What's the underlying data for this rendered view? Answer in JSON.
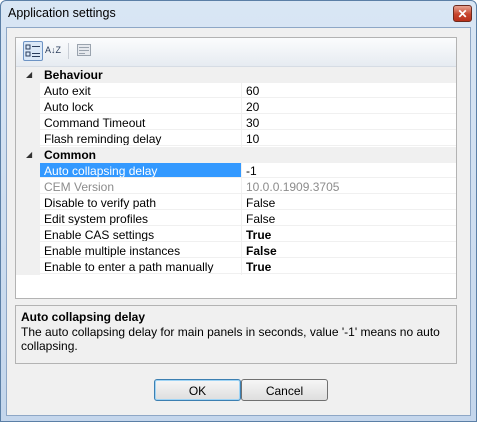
{
  "window": {
    "title": "Application settings",
    "close_glyph": "✕"
  },
  "toolbar": {
    "categorized_icon": "categorized-icon",
    "alphabetical_icon": "alphabetical-sort-icon",
    "alphabetical_glyph": "A↓Z",
    "property_pages_icon": "property-pages-icon"
  },
  "grid": {
    "categories": [
      {
        "label": "Behaviour",
        "toggle": "◢",
        "rows": [
          {
            "name": "Auto exit",
            "value": "60"
          },
          {
            "name": "Auto lock",
            "value": "20"
          },
          {
            "name": "Command Timeout",
            "value": "30"
          },
          {
            "name": "Flash reminding delay",
            "value": "10"
          }
        ]
      },
      {
        "label": "Common",
        "toggle": "◢",
        "rows": [
          {
            "name": "Auto collapsing delay",
            "value": "-1"
          },
          {
            "name": "CEM Version",
            "value": "10.0.0.1909.3705"
          },
          {
            "name": "Disable to verify path",
            "value": "False"
          },
          {
            "name": "Edit system profiles",
            "value": "False"
          },
          {
            "name": "Enable CAS settings",
            "value": "True"
          },
          {
            "name": "Enable multiple instances",
            "value": "False"
          },
          {
            "name": "Enable to enter a path manually",
            "value": "True"
          }
        ]
      }
    ]
  },
  "help": {
    "title": "Auto collapsing delay",
    "description_line1": "The auto collapsing delay for main panels in seconds, value '-1' means no auto",
    "description_line2": "collapsing."
  },
  "buttons": {
    "ok": "OK",
    "cancel": "Cancel"
  }
}
